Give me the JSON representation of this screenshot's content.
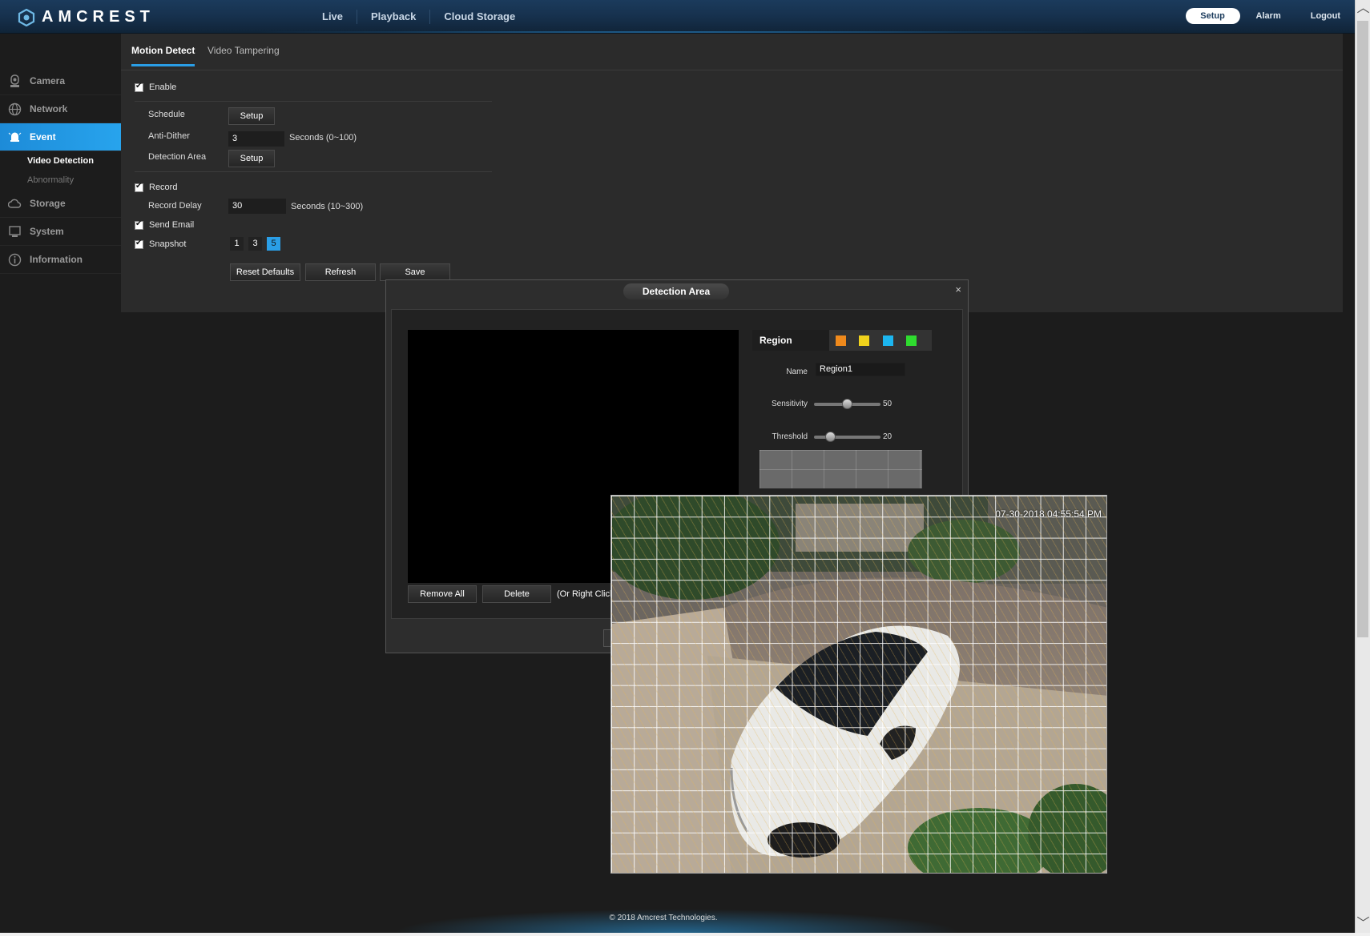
{
  "brand": {
    "name": "AMCREST"
  },
  "topnav": {
    "items": [
      "Live",
      "Playback",
      "Cloud Storage"
    ]
  },
  "topright": {
    "setup": "Setup",
    "alarm": "Alarm",
    "logout": "Logout"
  },
  "sidebar": {
    "items": [
      {
        "label": "Camera",
        "icon": "camera-icon"
      },
      {
        "label": "Network",
        "icon": "globe-icon"
      },
      {
        "label": "Event",
        "icon": "bell-icon"
      },
      {
        "label": "Storage",
        "icon": "cloud-icon"
      },
      {
        "label": "System",
        "icon": "monitor-icon"
      },
      {
        "label": "Information",
        "icon": "info-icon"
      }
    ],
    "event_sub": [
      "Video Detection",
      "Abnormality"
    ]
  },
  "tabs": [
    "Motion Detect",
    "Video Tampering"
  ],
  "form": {
    "enable": "Enable",
    "schedule": "Schedule",
    "schedule_btn": "Setup",
    "anti_dither": "Anti-Dither",
    "anti_dither_value": "3",
    "anti_dither_unit": "Seconds (0~100)",
    "detection_area": "Detection Area",
    "detection_area_btn": "Setup",
    "record": "Record",
    "record_delay": "Record Delay",
    "record_delay_value": "30",
    "record_delay_unit": "Seconds (10~300)",
    "send_email": "Send Email",
    "snapshot": "Snapshot",
    "snapshot_options": [
      "1",
      "3",
      "5"
    ],
    "snapshot_selected": "5",
    "reset_defaults": "Reset Defaults",
    "refresh": "Refresh",
    "save": "Save"
  },
  "dialog": {
    "title": "Detection Area",
    "close": "×",
    "region_label": "Region",
    "region_colors": [
      "#f08a1c",
      "#f0d21c",
      "#1cb6f0",
      "#2fdc2f"
    ],
    "name_label": "Name",
    "name_value": "Region1",
    "sensitivity_label": "Sensitivity",
    "sensitivity_value": "50",
    "threshold_label": "Threshold",
    "threshold_value": "20",
    "remove_all": "Remove All",
    "delete": "Delete",
    "right_click_hint": "(Or Right Click"
  },
  "camera": {
    "timestamp": "07-30-2018 04:55:54 PM"
  },
  "footer": {
    "copyright": "© 2018 Amcrest Technologies."
  },
  "accent": "#2a9ee6"
}
